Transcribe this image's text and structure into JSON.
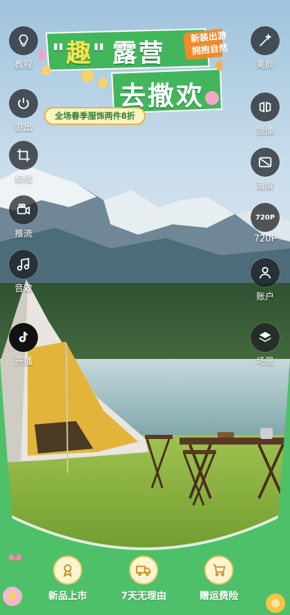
{
  "banner": {
    "quote_open": "\"",
    "qu_char": "趣",
    "quote_close": "\"",
    "line1_rest": "露营",
    "line2": "去撒欢",
    "tag_line1": "新装出游",
    "tag_line2": "拥抱自然",
    "promo": "全场春季服饰两件8折"
  },
  "left_controls": [
    {
      "label": "教程",
      "icon": "lightbulb-icon"
    },
    {
      "label": "退出",
      "icon": "power-icon"
    },
    {
      "label": "标线",
      "icon": "crop-lines-icon"
    },
    {
      "label": "推流",
      "icon": "camera-icon"
    },
    {
      "label": "音效",
      "icon": "music-note-icon"
    },
    {
      "label": "开播",
      "icon": "tiktok-icon"
    }
  ],
  "right_controls": [
    {
      "label": "美颜",
      "icon": "magic-wand-icon"
    },
    {
      "label": "镜像",
      "icon": "mirror-icon"
    },
    {
      "label": "清屏",
      "icon": "clear-screen-icon"
    },
    {
      "label": "720P",
      "icon": "resolution-icon",
      "badge": "720P"
    },
    {
      "label": "账户",
      "icon": "user-icon"
    },
    {
      "label": "场景",
      "icon": "layers-icon"
    }
  ],
  "benefits": [
    {
      "label": "新品上市",
      "icon": "medal-icon"
    },
    {
      "label": "7天无理由",
      "icon": "truck-icon"
    },
    {
      "label": "赠运费险",
      "icon": "cart-icon"
    }
  ],
  "colors": {
    "frame_green": "#4fc06a",
    "banner_green": "#3fb45a",
    "tag_orange": "#f08a2a",
    "promo_yellow": "#fff3c0",
    "control_bg": "#1c1f24"
  }
}
